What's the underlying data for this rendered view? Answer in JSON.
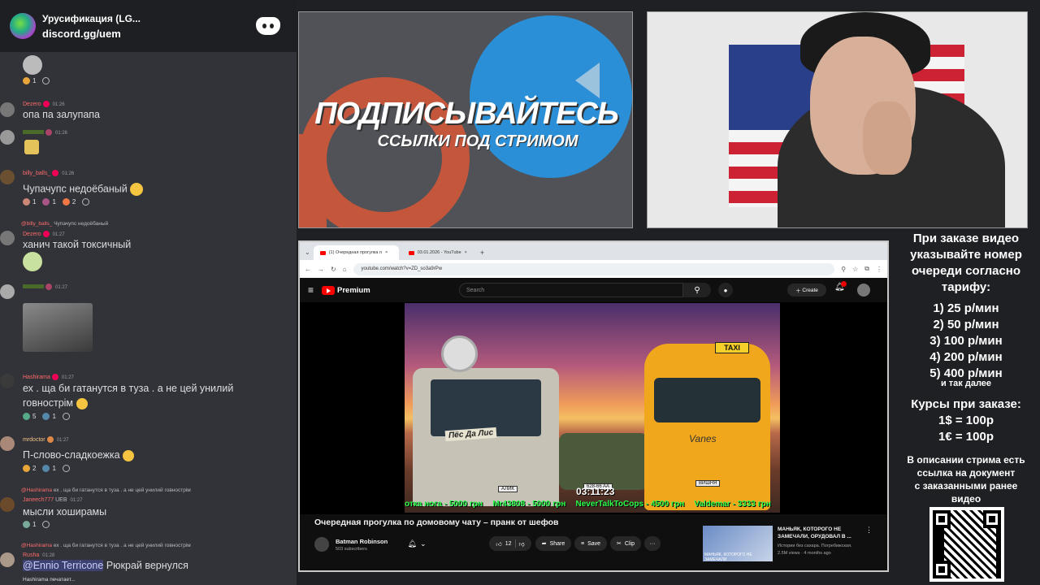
{
  "chat": {
    "server_title": "Урусификация (LG...",
    "invite": "discord.gg/uem",
    "messages": [
      {
        "reactions": [
          {
            "count": "1"
          }
        ]
      },
      {
        "user": "Dezero",
        "time": "01:26",
        "text": "опа па залупапа"
      },
      {
        "user": "",
        "time": "01:26"
      },
      {
        "user": "billy_balls_",
        "time": "01:26",
        "text": "Чупачупс недоёбаный",
        "reactions": [
          {
            "count": "1"
          },
          {
            "count": "1"
          },
          {
            "count": "2"
          }
        ]
      },
      {
        "reply_user": "@billy_balls_",
        "reply_text": "Чупачупс недоёбаный",
        "user": "Dezero",
        "time": "01:27",
        "text": "ханич такой токсичный"
      },
      {
        "user": "",
        "time": "01:27"
      },
      {
        "user": "Hashirama",
        "time": "01:27",
        "text": "ех . ща би гатанутся в туза . а не цей унилий",
        "text2": "говнострім",
        "reactions": [
          {
            "count": "5"
          },
          {
            "count": "1"
          }
        ]
      },
      {
        "user": "mrdoctor",
        "time": "01:27",
        "text": "П-слово-сладкоежка",
        "reactions": [
          {
            "count": "2"
          },
          {
            "count": "1"
          }
        ]
      },
      {
        "reply_user": "@Hashirama",
        "reply_text": "ех . ща би гатанутся в туза . а не цей унилий говнострім",
        "user": "Janeech777",
        "tag": "UEB",
        "time": "01:27",
        "text": "мысли хоширамы",
        "reactions": [
          {
            "count": "1"
          }
        ]
      },
      {
        "reply_user": "@Hashirama",
        "reply_text": "ех . ща би гатанутся в туза . а не цей унилий говнострім",
        "user": "Rusha",
        "time": "01:28",
        "mention": "@Ennio Terricone",
        "text": "Рюкрай вернулся"
      }
    ],
    "typing": "Hashirama печатает..."
  },
  "promo": {
    "headline": "ПОДПИСЫВАЙТЕСЬ",
    "subline": "ССЫЛКИ ПОД СТРИМОМ"
  },
  "browser": {
    "tabs": [
      {
        "label": "(1) Очередная прогулка п"
      },
      {
        "label": "03.01.2026 - YouTube"
      }
    ],
    "new_tab": "+",
    "url": "youtube.com/watch?v=ZD_so3a9rPw"
  },
  "youtube": {
    "brand": "Premium",
    "search_placeholder": "Search",
    "create_label": "Create",
    "video": {
      "title": "Очередная прогулка по домовому чату – пранк от шефов",
      "timer": "03:11:23",
      "ticker": [
        "отка нога - 5000 грн",
        "Mr43808 - 5000 грн",
        "NeverTalkToCops - 4500 грн",
        "Valdemar - 3333 грн",
        "К"
      ],
      "sign_dog": "Пёс Да Лис",
      "taxi_sign": "TAXI",
      "van_brand": "Vanes",
      "plate_1": "АЛИК",
      "plate_2": "ВИШНЯ",
      "plate_3": "628-66 AA"
    },
    "channel": {
      "name": "Batman Robinson",
      "subs": "503 subscribers"
    },
    "actions": {
      "likes": "12",
      "share": "Share",
      "save": "Save",
      "clip": "Clip",
      "more": "···"
    },
    "recommendation": {
      "title": "МАНЬЯК, КОТОРОГО НЕ ЗАМЕЧАЛИ, ОРУДОВАЛ В ...",
      "channel": "Истории без сахара. Погребижская.",
      "meta": "2.5M views · 4 months ago",
      "thumb_caption": "МАНЬЯК, КОТОРОГО НЕ ЗАМЕЧАЛИ"
    }
  },
  "prices": {
    "intro": [
      "При заказе видео",
      "указывайте номер",
      "очереди согласно",
      "тарифу:"
    ],
    "tiers": [
      "1) 25 р/мин",
      "2) 50 р/мин",
      "3) 100 р/мин",
      "4) 200 р/мин",
      "5) 400 р/мин"
    ],
    "etc": "и так далее",
    "rates_title": "Курсы при заказе:",
    "rates": [
      "1$ = 100р",
      "1€ = 100р"
    ],
    "desc": [
      "В описании стрима есть",
      "ссылка на документ",
      "с заказанными ранее",
      "видео"
    ]
  },
  "colors": {
    "discord_bg": "#313338",
    "yt_red": "#ff0000",
    "ticker_green": "#2bff4d",
    "promo_orange": "#c4563c",
    "telegram_blue": "#2a8fd6"
  }
}
